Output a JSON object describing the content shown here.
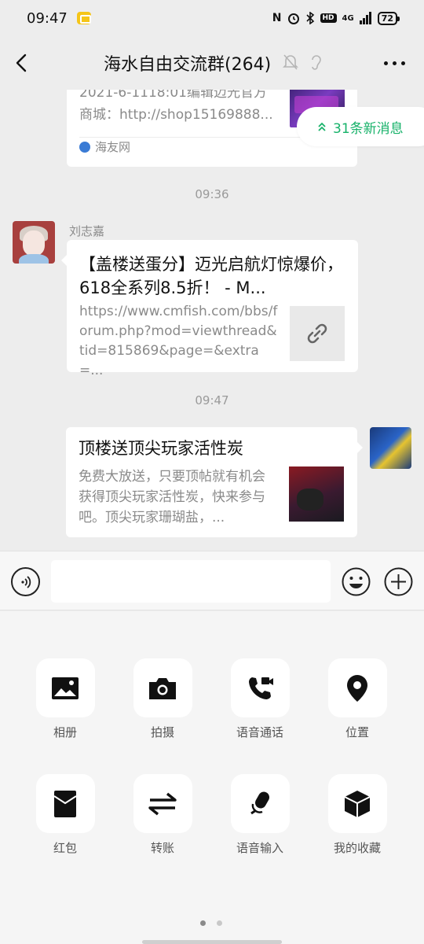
{
  "status_bar": {
    "time": "09:47",
    "network": "4G",
    "hd_label": "HD",
    "battery": "72"
  },
  "header": {
    "title": "海水自由交流群(264)"
  },
  "chat": {
    "new_messages_pill": "31条新消息",
    "messages": [
      {
        "desc": "2021-6-1118:01编辑迈光官方商城：http://shop15169888...",
        "source": "海友网"
      },
      {
        "time": "09:36",
        "sender": "刘志嘉",
        "title": "【盖楼送蛋分】迈光启航灯惊爆价，618全系列8.5折！ - M...",
        "desc": "https://www.cmfish.com/bbs/forum.php?mod=viewthread&tid=815869&page=&extra=..."
      },
      {
        "time": "09:47",
        "title": "顶楼送顶尖玩家活性炭",
        "desc": "免费大放送，只要顶帖就有机会获得顶尖玩家活性炭，快来参与吧。顶尖玩家珊瑚盐，..."
      }
    ]
  },
  "input": {
    "value": "",
    "placeholder": ""
  },
  "panel": {
    "tools": [
      {
        "label": "相册",
        "icon": "image-icon"
      },
      {
        "label": "拍摄",
        "icon": "camera-icon"
      },
      {
        "label": "语音通话",
        "icon": "voice-call-icon"
      },
      {
        "label": "位置",
        "icon": "location-icon"
      },
      {
        "label": "红包",
        "icon": "red-packet-icon"
      },
      {
        "label": "转账",
        "icon": "transfer-icon"
      },
      {
        "label": "语音输入",
        "icon": "microphone-icon"
      },
      {
        "label": "我的收藏",
        "icon": "favorites-icon"
      }
    ],
    "page_count": 2,
    "current_page": 1
  },
  "colors": {
    "accent_green": "#17b26a",
    "background": "#ededed",
    "bubble": "#ffffff"
  }
}
